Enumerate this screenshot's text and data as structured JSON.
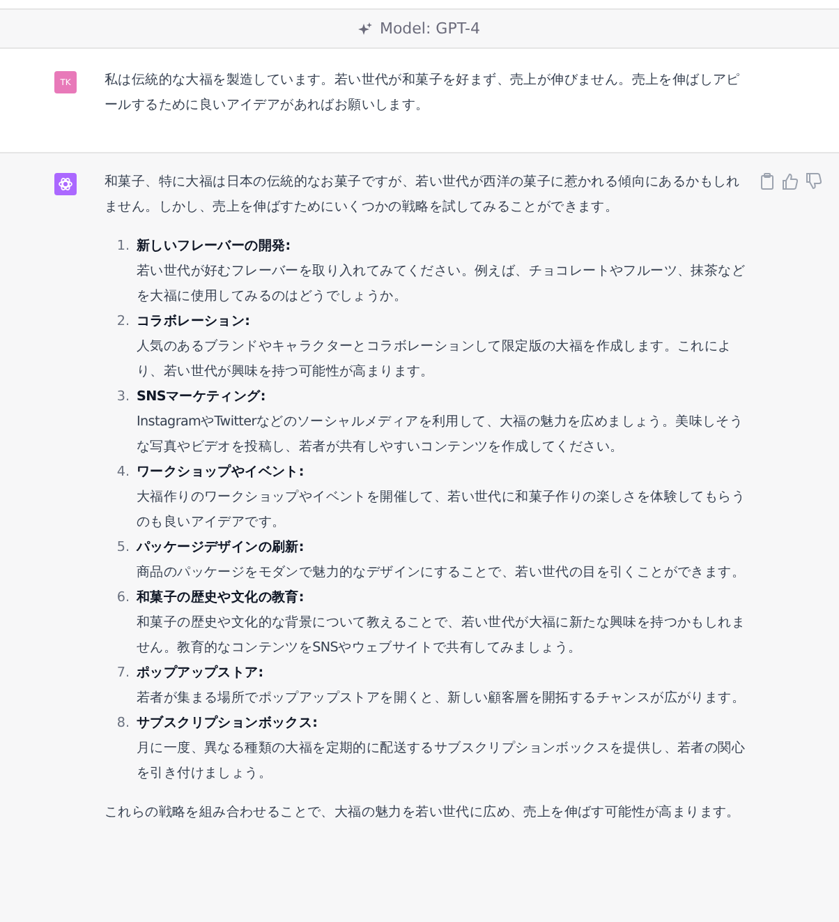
{
  "header": {
    "model_label": "Model: GPT-4"
  },
  "user_message": {
    "avatar": "TK",
    "text": "私は伝統的な大福を製造しています。若い世代が和菓子を好まず、売上が伸びません。売上を伸ばしアピールするために良いアイデアがあればお願いします。"
  },
  "assistant_message": {
    "intro": "和菓子、特に大福は日本の伝統的なお菓子ですが、若い世代が西洋の菓子に惹かれる傾向にあるかもしれません。しかし、売上を伸ばすためにいくつかの戦略を試してみることができます。",
    "items": [
      {
        "number": "1.",
        "title": "新しいフレーバーの開発:",
        "body": "若い世代が好むフレーバーを取り入れてみてください。例えば、チョコレートやフルーツ、抹茶などを大福に使用してみるのはどうでしょうか。"
      },
      {
        "number": "2.",
        "title": "コラボレーション:",
        "body": "人気のあるブランドやキャラクターとコラボレーションして限定版の大福を作成します。これにより、若い世代が興味を持つ可能性が高まります。"
      },
      {
        "number": "3.",
        "title": "SNSマーケティング:",
        "body": "InstagramやTwitterなどのソーシャルメディアを利用して、大福の魅力を広めましょう。美味しそうな写真やビデオを投稿し、若者が共有しやすいコンテンツを作成してください。"
      },
      {
        "number": "4.",
        "title": "ワークショップやイベント:",
        "body": "大福作りのワークショップやイベントを開催して、若い世代に和菓子作りの楽しさを体験してもらうのも良いアイデアです。"
      },
      {
        "number": "5.",
        "title": "パッケージデザインの刷新:",
        "body": "商品のパッケージをモダンで魅力的なデザインにすることで、若い世代の目を引くことができます。"
      },
      {
        "number": "6.",
        "title": "和菓子の歴史や文化の教育:",
        "body": "和菓子の歴史や文化的な背景について教えることで、若い世代が大福に新たな興味を持つかもしれません。教育的なコンテンツをSNSやウェブサイトで共有してみましょう。"
      },
      {
        "number": "7.",
        "title": "ポップアップストア:",
        "body": "若者が集まる場所でポップアップストアを開くと、新しい顧客層を開拓するチャンスが広がります。"
      },
      {
        "number": "8.",
        "title": "サブスクリプションボックス:",
        "body": "月に一度、異なる種類の大福を定期的に配送するサブスクリプションボックスを提供し、若者の関心を引き付けましょう。"
      }
    ],
    "conclusion": "これらの戦略を組み合わせることで、大福の魅力を若い世代に広め、売上を伸ばす可能性が高まります。"
  }
}
